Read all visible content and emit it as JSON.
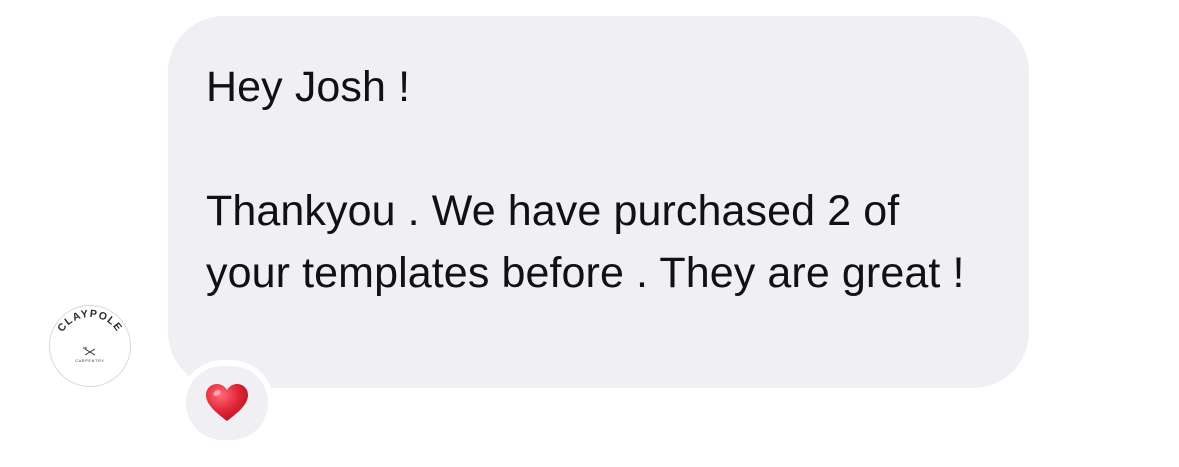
{
  "conversation": {
    "sender_avatar": {
      "brand_name": "CLAYPOLE",
      "brand_tagline": "CARPENTRY",
      "icon": "hammer-saw-crossed-icon"
    },
    "message": {
      "greeting": "Hey Josh !",
      "body": "Thankyou . We have purchased 2 of your templates before . They are great !"
    },
    "reaction": {
      "icon": "red-heart-icon",
      "color": "#e2283a"
    },
    "colors": {
      "bubble_background": "#efeff4",
      "text": "#111111"
    }
  }
}
